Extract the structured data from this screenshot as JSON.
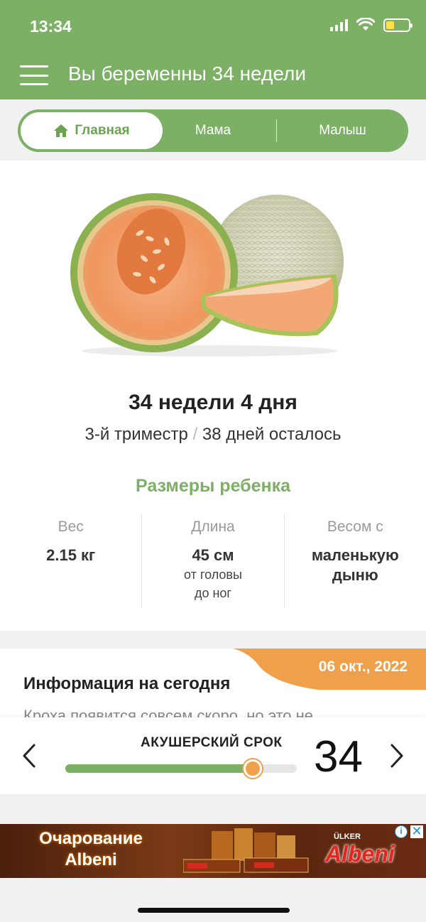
{
  "status": {
    "time": "13:34"
  },
  "header": {
    "title": "Вы беременны 34 недели",
    "color": "#7bb065"
  },
  "tabs": {
    "home": "Главная",
    "mom": "Мама",
    "baby": "Малыш",
    "active": "home"
  },
  "summary": {
    "week_title": "34 недели 4 дня",
    "trimester": "3-й триместр",
    "separator": "/",
    "remaining": "38 дней осталось"
  },
  "sizes": {
    "title": "Размеры ребенка",
    "weight": {
      "label": "Вес",
      "value": "2.15 кг"
    },
    "length": {
      "label": "Длина",
      "value": "45 см",
      "note_line1": "от головы",
      "note_line2": "до ног"
    },
    "compare": {
      "label": "Весом с",
      "value_line1": "маленькую",
      "value_line2": "дыню"
    }
  },
  "info": {
    "date": "06 окт., 2022",
    "title": "Информация на сегодня",
    "text": "Кроха появится совсем скоро, но это не"
  },
  "slider": {
    "label": "АКУШЕРСКИЙ СРОК",
    "week": "34",
    "progress": 0.81,
    "accent": "#f0a04b"
  },
  "ad": {
    "left_line1": "Очарование",
    "left_line2": "Albeni",
    "brand_top": "ÜLKER",
    "brand": "Albeni",
    "info_glyph": "i",
    "close_glyph": "✕"
  }
}
